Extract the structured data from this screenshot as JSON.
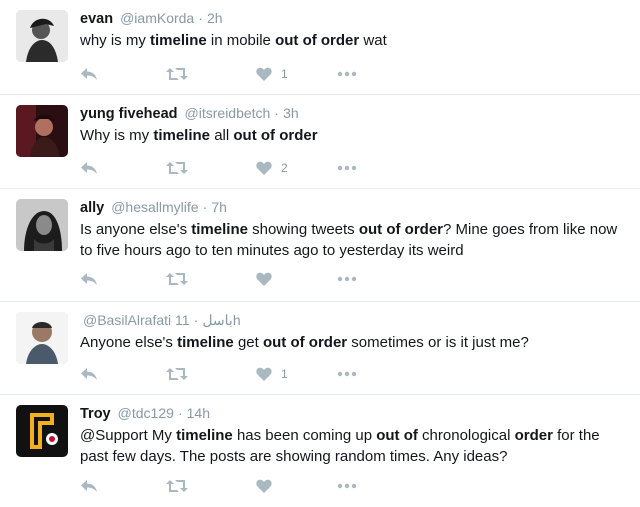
{
  "tweets": [
    {
      "name": "evan",
      "handle": "@iamKorda",
      "sep": "·",
      "time": "2h",
      "text": [
        {
          "t": "why is my "
        },
        {
          "t": "timeline",
          "b": true
        },
        {
          "t": " in mobile "
        },
        {
          "t": "out of order",
          "b": true
        },
        {
          "t": " wat"
        }
      ],
      "likes": "1"
    },
    {
      "name": "yung fivehead",
      "handle": "@itsreidbetch",
      "sep": "·",
      "time": "3h",
      "text": [
        {
          "t": "Why is my "
        },
        {
          "t": "timeline",
          "b": true
        },
        {
          "t": " all "
        },
        {
          "t": "out of order",
          "b": true
        }
      ],
      "likes": "2"
    },
    {
      "name": "ally",
      "handle": "@hesallmylife",
      "sep": "·",
      "time": "7h",
      "text": [
        {
          "t": "Is anyone else's "
        },
        {
          "t": "timeline",
          "b": true
        },
        {
          "t": " showing tweets "
        },
        {
          "t": "out of order",
          "b": true
        },
        {
          "t": "? Mine goes from like now to five hours ago to ten minutes ago to yesterday its weird"
        }
      ],
      "likes": ""
    },
    {
      "name": "",
      "handle": "@BasilAlrafati باسل",
      "sep": "·",
      "time": "11h",
      "text": [
        {
          "t": "Anyone else's "
        },
        {
          "t": "timeline",
          "b": true
        },
        {
          "t": " get "
        },
        {
          "t": "out of order",
          "b": true
        },
        {
          "t": " sometimes or is it just me?"
        }
      ],
      "likes": "1"
    },
    {
      "name": "Troy",
      "handle": "@tdc129",
      "sep": "·",
      "time": "14h",
      "text": [
        {
          "t": "@Support My "
        },
        {
          "t": "timeline",
          "b": true
        },
        {
          "t": " has been coming up "
        },
        {
          "t": "out of",
          "b": true
        },
        {
          "t": " chronological "
        },
        {
          "t": "order",
          "b": true
        },
        {
          "t": " for the past few days. The posts are showing random times.  Any ideas?"
        }
      ],
      "likes": ""
    }
  ]
}
